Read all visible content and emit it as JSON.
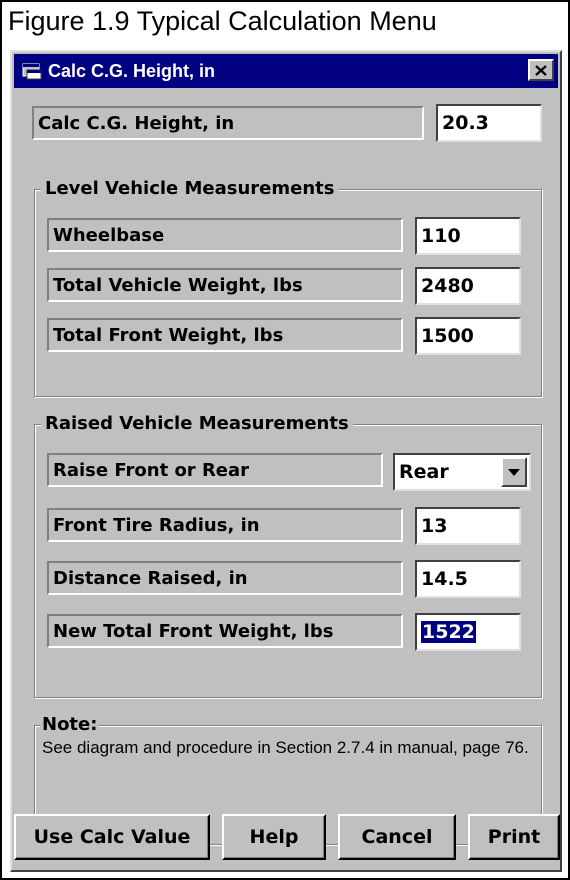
{
  "figure_caption": "Figure 1.9  Typical Calculation Menu",
  "window": {
    "title": "Calc C.G. Height, in",
    "icons": {
      "app": "app-icon",
      "close": "close-icon"
    }
  },
  "result": {
    "label": "Calc C.G. Height, in",
    "value": "20.3"
  },
  "level_group": {
    "title": "Level Vehicle Measurements",
    "rows": [
      {
        "label": "Wheelbase",
        "value": "110"
      },
      {
        "label": "Total Vehicle Weight, lbs",
        "value": "2480"
      },
      {
        "label": "Total Front Weight, lbs",
        "value": "1500"
      }
    ]
  },
  "raised_group": {
    "title": "Raised Vehicle Measurements",
    "raise_label": "Raise Front or Rear",
    "raise_value": "Rear",
    "rows": [
      {
        "label": "Front Tire Radius, in",
        "value": "13"
      },
      {
        "label": "Distance Raised, in",
        "value": "14.5"
      },
      {
        "label": "New Total Front Weight, lbs",
        "value": "1522"
      }
    ]
  },
  "note": {
    "title": "Note:",
    "text": "See diagram and procedure in Section 2.7.4 in manual, page 76."
  },
  "buttons": {
    "use_calc": "Use Calc Value",
    "help": "Help",
    "cancel": "Cancel",
    "print": "Print"
  }
}
